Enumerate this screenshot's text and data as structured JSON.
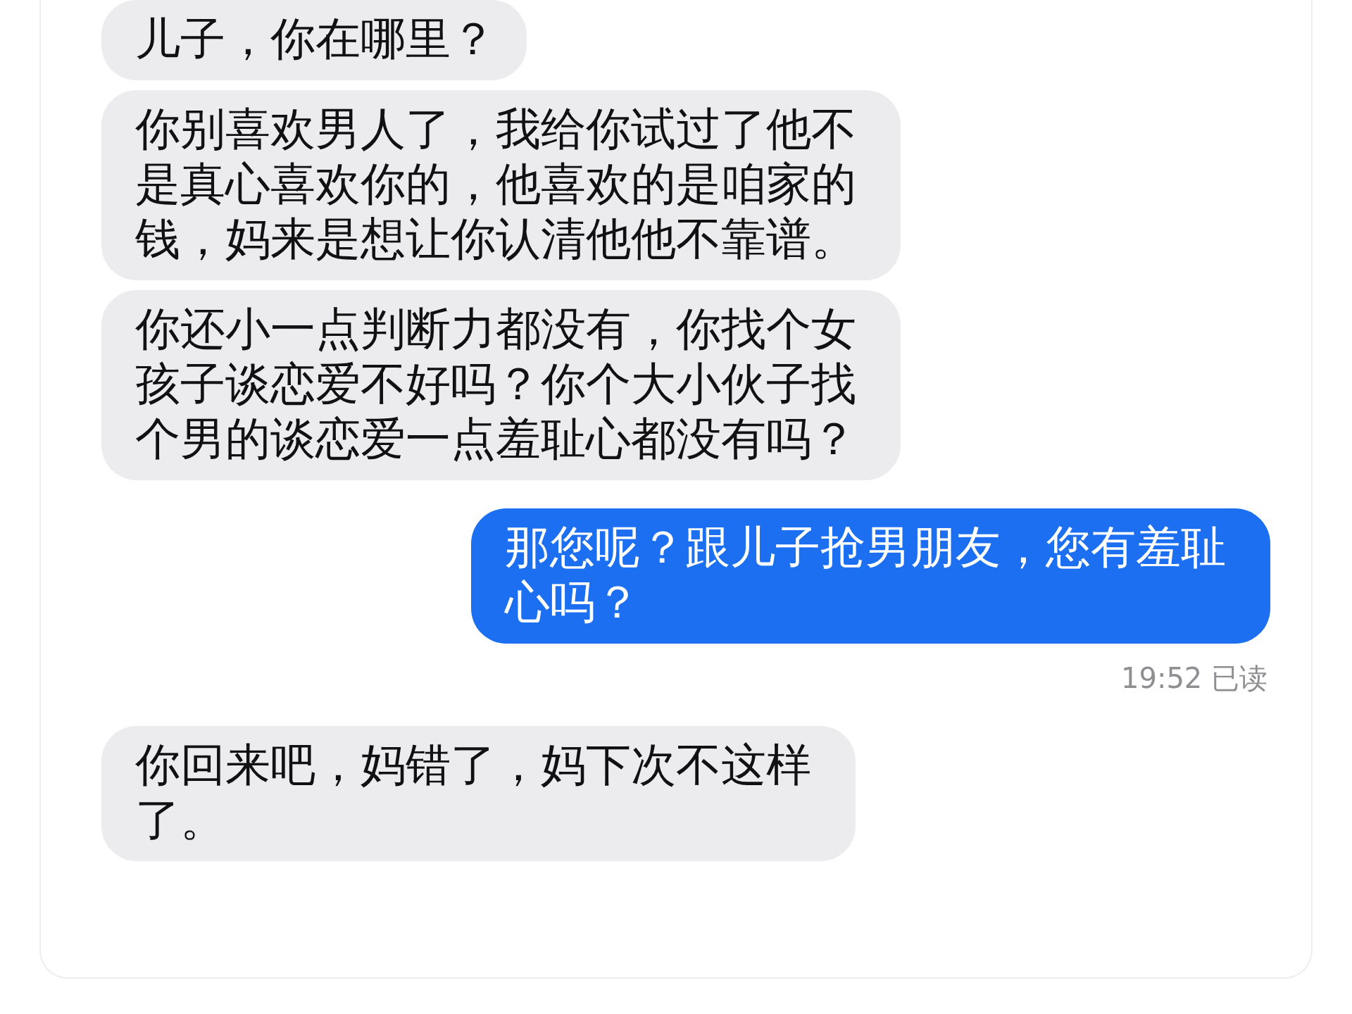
{
  "messages": [
    {
      "kind": "incoming",
      "text": "儿子，你在哪里？"
    },
    {
      "kind": "incoming",
      "text": "你别喜欢男人了，我给你试过了他不是真心喜欢你的，他喜欢的是咱家的钱，妈来是想让你认清他他不靠谱。"
    },
    {
      "kind": "incoming",
      "text": "你还小一点判断力都没有，你找个女孩子谈恋爱不好吗？你个大小伙子找个男的谈恋爱一点羞耻心都没有吗？"
    },
    {
      "kind": "outgoing",
      "text": "那您呢？跟儿子抢男朋友，您有羞耻心吗？",
      "receipt": "19:52 已读"
    },
    {
      "kind": "incoming",
      "text": "你回来吧，妈错了，妈下次不这样了。"
    }
  ]
}
